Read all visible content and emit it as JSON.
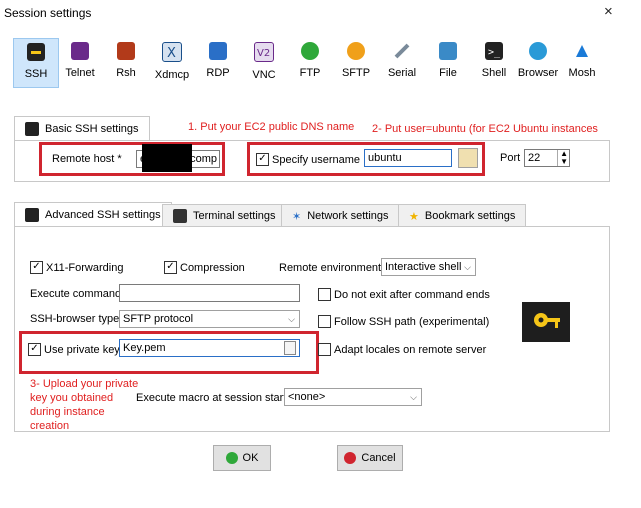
{
  "window": {
    "title": "Session settings",
    "close": "×"
  },
  "protocols": [
    {
      "label": "SSH",
      "icon": "ssh-icon",
      "color": "#222222",
      "selected": true
    },
    {
      "label": "Telnet",
      "icon": "telnet-icon",
      "color": "#6a2a8a",
      "selected": false
    },
    {
      "label": "Rsh",
      "icon": "rsh-icon",
      "color": "#b23a1a",
      "selected": false
    },
    {
      "label": "Xdmcp",
      "icon": "xdmcp-icon",
      "color": "#1a4f8a",
      "selected": false
    },
    {
      "label": "RDP",
      "icon": "rdp-icon",
      "color": "#2a6fc7",
      "selected": false
    },
    {
      "label": "VNC",
      "icon": "vnc-icon",
      "color": "#6a2a8a",
      "selected": false
    },
    {
      "label": "FTP",
      "icon": "ftp-icon",
      "color": "#2fa83a",
      "selected": false
    },
    {
      "label": "SFTP",
      "icon": "sftp-icon",
      "color": "#f0a01a",
      "selected": false
    },
    {
      "label": "Serial",
      "icon": "serial-icon",
      "color": "#7a8a9a",
      "selected": false
    },
    {
      "label": "File",
      "icon": "file-icon",
      "color": "#3a8ac7",
      "selected": false
    },
    {
      "label": "Shell",
      "icon": "shell-icon",
      "color": "#222222",
      "selected": false
    },
    {
      "label": "Browser",
      "icon": "browser-icon",
      "color": "#2a9ad7",
      "selected": false
    },
    {
      "label": "Mosh",
      "icon": "mosh-icon",
      "color": "#1a7ad7",
      "selected": false
    }
  ],
  "basic": {
    "tab_label": "Basic SSH settings",
    "remote_host_label": "Remote host *",
    "remote_host_value_start": "ec2",
    "remote_host_value_end": "comp",
    "specify_username_label": "Specify username",
    "username_value": "ubuntu",
    "port_label": "Port",
    "port_value": "22"
  },
  "annotations": {
    "a1": "1. Put your EC2 public DNS name",
    "a2": "2- Put user=ubuntu (for EC2 Ubuntu instances",
    "a3_l1": "3- Upload your private",
    "a3_l2": "key you obtained",
    "a3_l3": "during instance",
    "a3_l4": "creation"
  },
  "tabs": [
    {
      "label": "Advanced SSH settings",
      "active": true
    },
    {
      "label": "Terminal settings",
      "active": false
    },
    {
      "label": "Network settings",
      "active": false
    },
    {
      "label": "Bookmark settings",
      "active": false
    }
  ],
  "advanced": {
    "x11_label": "X11-Forwarding",
    "compression_label": "Compression",
    "remote_env_label": "Remote environment:",
    "remote_env_value": "Interactive shell",
    "exec_cmd_label": "Execute command:",
    "exec_cmd_value": "",
    "no_exit_label": "Do not exit after command ends",
    "browser_type_label": "SSH-browser type:",
    "browser_type_value": "SFTP protocol",
    "follow_path_label": "Follow SSH path (experimental)",
    "private_key_label": "Use private key",
    "private_key_value": "Key.pem",
    "adapt_locales_label": "Adapt locales on remote server",
    "macro_label": "Execute macro at session start:",
    "macro_value": "<none>"
  },
  "buttons": {
    "ok": "OK",
    "cancel": "Cancel"
  },
  "colors": {
    "accent_red": "#d0252f",
    "selected_bg": "#cfe6fb",
    "key_bg": "#1e1e1e",
    "key_yellow": "#f5c518"
  }
}
